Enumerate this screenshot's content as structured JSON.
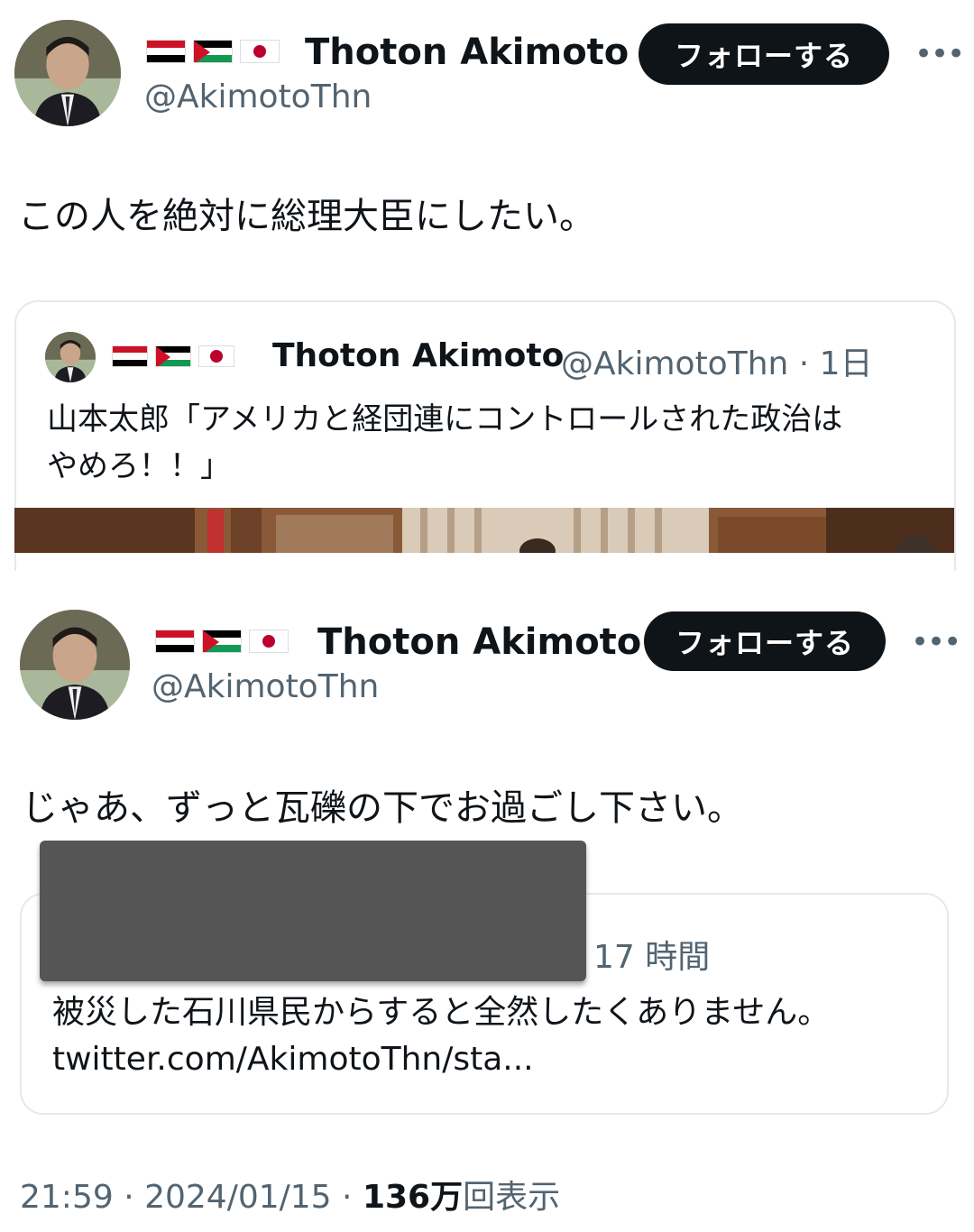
{
  "tweet1": {
    "display_name": "Thoton Akimoto",
    "handle": "@AkimotoThn",
    "follow_label": "フォローする",
    "more_label": "•••",
    "text": "この人を絶対に総理大臣にしたい。",
    "flags": [
      "egypt-flag-icon",
      "palestine-flag-icon",
      "japan-flag-icon"
    ]
  },
  "quote1": {
    "display_name": "Thoton Akimoto",
    "meta": "@AkimotoThn · 1日",
    "text_line1": "山本太郎「アメリカと経団連にコントロールされた政治は",
    "text_line2": "やめろ！！」"
  },
  "tweet2": {
    "display_name": "Thoton Akimoto",
    "handle": "@AkimotoThn",
    "follow_label": "フォローする",
    "more_label": "•••",
    "text": "じゃあ、ずっと瓦礫の下でお過ごし下さい。"
  },
  "quote2": {
    "time": "17 時間",
    "text": "被災した石川県民からすると全然したくありません。",
    "link": "twitter.com/AkimotoThn/sta..."
  },
  "footer": {
    "time": "21:59",
    "sep1": " · ",
    "date": "2024/01/15",
    "sep2": " · ",
    "views_number": "136万",
    "views_label": "回表示"
  },
  "colors": {
    "text_primary": "#0f1419",
    "text_secondary": "#536471",
    "button_bg": "#0f1419",
    "border": "#e6e9eb",
    "redaction": "#555555"
  }
}
